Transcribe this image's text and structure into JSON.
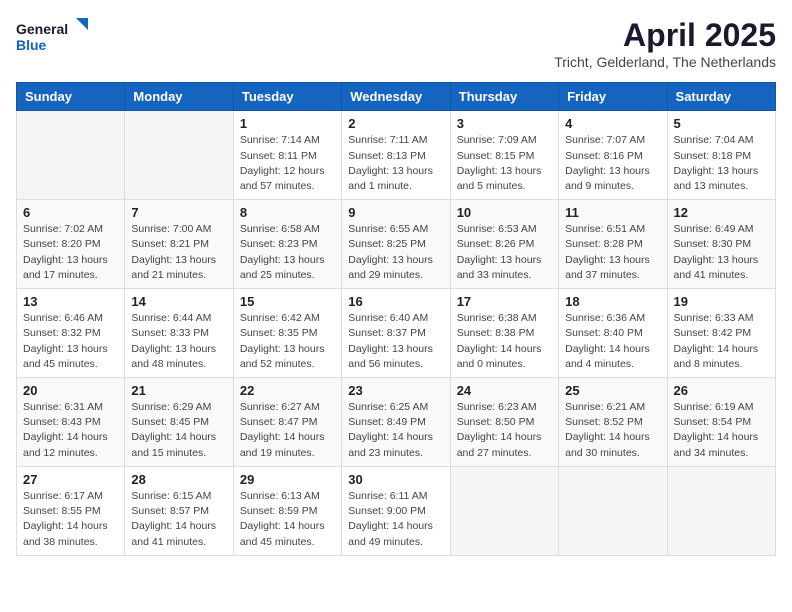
{
  "header": {
    "logo_general": "General",
    "logo_blue": "Blue",
    "title": "April 2025",
    "subtitle": "Tricht, Gelderland, The Netherlands"
  },
  "days_of_week": [
    "Sunday",
    "Monday",
    "Tuesday",
    "Wednesday",
    "Thursday",
    "Friday",
    "Saturday"
  ],
  "weeks": [
    [
      {
        "day": "",
        "info": ""
      },
      {
        "day": "",
        "info": ""
      },
      {
        "day": "1",
        "info": "Sunrise: 7:14 AM\nSunset: 8:11 PM\nDaylight: 12 hours and 57 minutes."
      },
      {
        "day": "2",
        "info": "Sunrise: 7:11 AM\nSunset: 8:13 PM\nDaylight: 13 hours and 1 minute."
      },
      {
        "day": "3",
        "info": "Sunrise: 7:09 AM\nSunset: 8:15 PM\nDaylight: 13 hours and 5 minutes."
      },
      {
        "day": "4",
        "info": "Sunrise: 7:07 AM\nSunset: 8:16 PM\nDaylight: 13 hours and 9 minutes."
      },
      {
        "day": "5",
        "info": "Sunrise: 7:04 AM\nSunset: 8:18 PM\nDaylight: 13 hours and 13 minutes."
      }
    ],
    [
      {
        "day": "6",
        "info": "Sunrise: 7:02 AM\nSunset: 8:20 PM\nDaylight: 13 hours and 17 minutes."
      },
      {
        "day": "7",
        "info": "Sunrise: 7:00 AM\nSunset: 8:21 PM\nDaylight: 13 hours and 21 minutes."
      },
      {
        "day": "8",
        "info": "Sunrise: 6:58 AM\nSunset: 8:23 PM\nDaylight: 13 hours and 25 minutes."
      },
      {
        "day": "9",
        "info": "Sunrise: 6:55 AM\nSunset: 8:25 PM\nDaylight: 13 hours and 29 minutes."
      },
      {
        "day": "10",
        "info": "Sunrise: 6:53 AM\nSunset: 8:26 PM\nDaylight: 13 hours and 33 minutes."
      },
      {
        "day": "11",
        "info": "Sunrise: 6:51 AM\nSunset: 8:28 PM\nDaylight: 13 hours and 37 minutes."
      },
      {
        "day": "12",
        "info": "Sunrise: 6:49 AM\nSunset: 8:30 PM\nDaylight: 13 hours and 41 minutes."
      }
    ],
    [
      {
        "day": "13",
        "info": "Sunrise: 6:46 AM\nSunset: 8:32 PM\nDaylight: 13 hours and 45 minutes."
      },
      {
        "day": "14",
        "info": "Sunrise: 6:44 AM\nSunset: 8:33 PM\nDaylight: 13 hours and 48 minutes."
      },
      {
        "day": "15",
        "info": "Sunrise: 6:42 AM\nSunset: 8:35 PM\nDaylight: 13 hours and 52 minutes."
      },
      {
        "day": "16",
        "info": "Sunrise: 6:40 AM\nSunset: 8:37 PM\nDaylight: 13 hours and 56 minutes."
      },
      {
        "day": "17",
        "info": "Sunrise: 6:38 AM\nSunset: 8:38 PM\nDaylight: 14 hours and 0 minutes."
      },
      {
        "day": "18",
        "info": "Sunrise: 6:36 AM\nSunset: 8:40 PM\nDaylight: 14 hours and 4 minutes."
      },
      {
        "day": "19",
        "info": "Sunrise: 6:33 AM\nSunset: 8:42 PM\nDaylight: 14 hours and 8 minutes."
      }
    ],
    [
      {
        "day": "20",
        "info": "Sunrise: 6:31 AM\nSunset: 8:43 PM\nDaylight: 14 hours and 12 minutes."
      },
      {
        "day": "21",
        "info": "Sunrise: 6:29 AM\nSunset: 8:45 PM\nDaylight: 14 hours and 15 minutes."
      },
      {
        "day": "22",
        "info": "Sunrise: 6:27 AM\nSunset: 8:47 PM\nDaylight: 14 hours and 19 minutes."
      },
      {
        "day": "23",
        "info": "Sunrise: 6:25 AM\nSunset: 8:49 PM\nDaylight: 14 hours and 23 minutes."
      },
      {
        "day": "24",
        "info": "Sunrise: 6:23 AM\nSunset: 8:50 PM\nDaylight: 14 hours and 27 minutes."
      },
      {
        "day": "25",
        "info": "Sunrise: 6:21 AM\nSunset: 8:52 PM\nDaylight: 14 hours and 30 minutes."
      },
      {
        "day": "26",
        "info": "Sunrise: 6:19 AM\nSunset: 8:54 PM\nDaylight: 14 hours and 34 minutes."
      }
    ],
    [
      {
        "day": "27",
        "info": "Sunrise: 6:17 AM\nSunset: 8:55 PM\nDaylight: 14 hours and 38 minutes."
      },
      {
        "day": "28",
        "info": "Sunrise: 6:15 AM\nSunset: 8:57 PM\nDaylight: 14 hours and 41 minutes."
      },
      {
        "day": "29",
        "info": "Sunrise: 6:13 AM\nSunset: 8:59 PM\nDaylight: 14 hours and 45 minutes."
      },
      {
        "day": "30",
        "info": "Sunrise: 6:11 AM\nSunset: 9:00 PM\nDaylight: 14 hours and 49 minutes."
      },
      {
        "day": "",
        "info": ""
      },
      {
        "day": "",
        "info": ""
      },
      {
        "day": "",
        "info": ""
      }
    ]
  ]
}
